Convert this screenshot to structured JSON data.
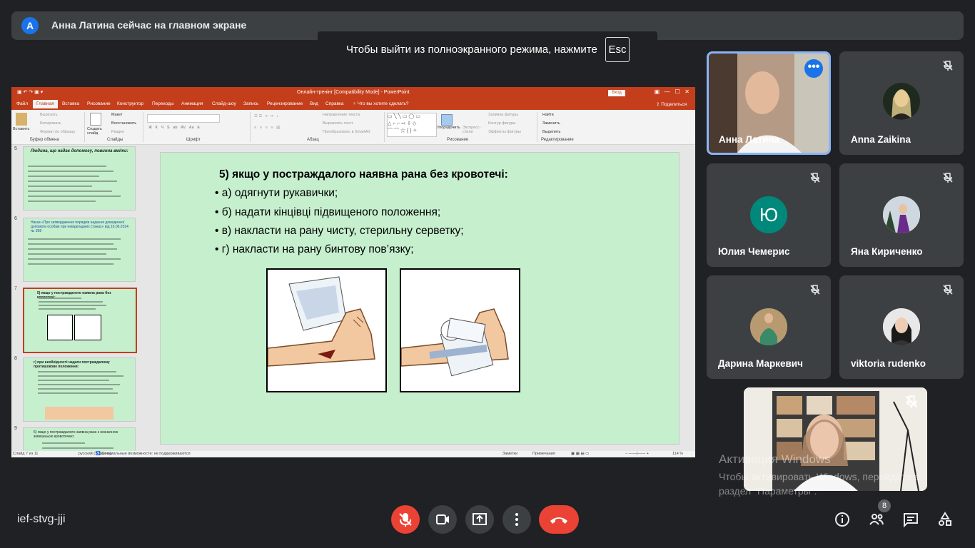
{
  "presenter": {
    "initial": "А",
    "text": "Анна Латина сейчас на главном экране"
  },
  "toast": {
    "text": "Чтобы выйти из полноэкранного режима, нажмите",
    "key": "Esc"
  },
  "ppt": {
    "title": "Онлайн-тренінг [Compatibility Mode] - PowerPoint",
    "login": "Вход",
    "tabs": [
      "Файл",
      "Главная",
      "Вставка",
      "Рисование",
      "Конструктор",
      "Переходы",
      "Анимация",
      "Слайд-шоу",
      "Запись",
      "Рецензирование",
      "Вид",
      "Справка",
      "Что вы хотите сделать?"
    ],
    "share": "Поделиться",
    "ribbon": {
      "paste": "Вставить",
      "cut": "Вырезать",
      "copy": "Копировать",
      "format_painter": "Формат по образцу",
      "clipboard": "Буфер обмена",
      "new_slide": "Создать слайд",
      "layout": "Макет",
      "reset": "Восстановить",
      "section": "Раздел",
      "slides": "Слайды",
      "font": "Шрифт",
      "paragraph": "Абзац",
      "text_direction": "Направление текста",
      "align_text": "Выровнять текст",
      "smartart": "Преобразовать в SmartArt",
      "arrange": "Упорядочить",
      "quick_styles": "Экспресс-стили",
      "shape_fill": "Заливка фигуры",
      "shape_outline": "Контур фигуры",
      "shape_effects": "Эффекты фигуры",
      "drawing": "Рисование",
      "find": "Найти",
      "replace": "Заменить",
      "select": "Выделить",
      "editing": "Редактирование"
    },
    "thumbnails": [
      {
        "num": "5",
        "title": "Людина, що надає допомогу, повинна вміти:"
      },
      {
        "num": "6",
        "title": "Наказ «Про затвердження порядків надання домедичної допомоги особам при невідкладних станах» від 16.06.2014 № 398"
      },
      {
        "num": "7",
        "title": "5) якщо у постраждалого наявна рана без кровотечі:"
      },
      {
        "num": "8",
        "title": "г) при необхідності надати постраждалому протишокове положення:"
      },
      {
        "num": "9",
        "title": "6) якщо у постраждалого наявна рана з незначною зовнішньою кровотечею:"
      }
    ],
    "slide": {
      "title": "5) якщо у постраждалого наявна рана без кровотечі:",
      "bullets": [
        "а) одягнути рукавички;",
        "б) надати кінцівці підвищеного положення;",
        "в) накласти на рану чисту, стерильну серветку;",
        "г) накласти на рану бинтову пов’язку;"
      ]
    },
    "status": {
      "slide": "Слайд 7 из 11",
      "lang": "русский (Украина)",
      "accessibility": "Специальные возможности: не поддерживаются",
      "notes": "Заметки",
      "comments": "Примечания",
      "zoom": "114 %"
    }
  },
  "participants": [
    {
      "name": "Анна Латина",
      "initial": ""
    },
    {
      "name": "Anna Zaikina",
      "initial": ""
    },
    {
      "name": "Юлия Чемерис",
      "initial": "Ю"
    },
    {
      "name": "Яна Кириченко",
      "initial": ""
    },
    {
      "name": "Дарина Маркевич",
      "initial": ""
    },
    {
      "name": "viktoria rudenko",
      "initial": ""
    }
  ],
  "meeting_code": "ief-stvg-jji",
  "participant_count": "8",
  "watermark": {
    "line1": "Активация Windows",
    "line2": "Чтобы активировать Windows, перейдите в раздел \"Параметры\"."
  },
  "colors": {
    "accent": "#1a73e8",
    "danger": "#ea4335",
    "ppt_red": "#c43e1c",
    "slide_bg": "#c6efce"
  }
}
